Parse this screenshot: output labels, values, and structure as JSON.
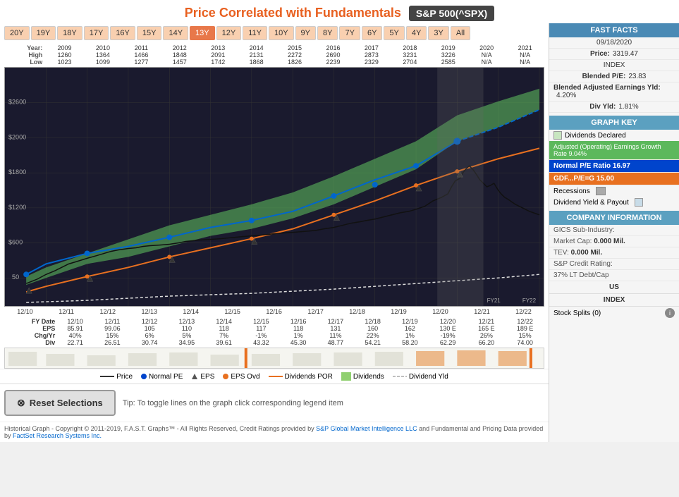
{
  "title": {
    "main": "Price Correlated with Fundamentals",
    "index": "S&P 500(^SPX)"
  },
  "timeButtons": [
    {
      "label": "20Y",
      "active": false
    },
    {
      "label": "19Y",
      "active": false
    },
    {
      "label": "18Y",
      "active": false
    },
    {
      "label": "17Y",
      "active": false
    },
    {
      "label": "16Y",
      "active": false
    },
    {
      "label": "15Y",
      "active": false
    },
    {
      "label": "14Y",
      "active": false
    },
    {
      "label": "13Y",
      "active": true
    },
    {
      "label": "12Y",
      "active": false
    },
    {
      "label": "11Y",
      "active": false
    },
    {
      "label": "10Y",
      "active": false
    },
    {
      "label": "9Y",
      "active": false
    },
    {
      "label": "8Y",
      "active": false
    },
    {
      "label": "7Y",
      "active": false
    },
    {
      "label": "6Y",
      "active": false
    },
    {
      "label": "5Y",
      "active": false
    },
    {
      "label": "4Y",
      "active": false
    },
    {
      "label": "3Y",
      "active": false
    },
    {
      "label": "All",
      "active": false
    }
  ],
  "yearRow": {
    "label": "Year:",
    "years": [
      "2009",
      "2010",
      "2011",
      "2012",
      "2013",
      "2014",
      "2015",
      "2016",
      "2017",
      "2018",
      "2019",
      "2020",
      "2021"
    ]
  },
  "highRow": {
    "label": "High",
    "values": [
      "1260",
      "1364",
      "1466",
      "1848",
      "2091",
      "2131",
      "2272",
      "2690",
      "2873",
      "3231",
      "3226",
      "N/A",
      "N/A"
    ]
  },
  "lowRow": {
    "label": "Low",
    "values": [
      "1023",
      "1099",
      "1277",
      "1457",
      "1742",
      "1868",
      "1826",
      "2239",
      "2329",
      "2704",
      "2585",
      "N/A",
      "N/A"
    ]
  },
  "xAxisLabels": [
    "12/10",
    "12/11",
    "12/12",
    "12/13",
    "12/14",
    "12/15",
    "12/16",
    "12/17",
    "12/18",
    "12/19",
    "12/20",
    "12/21",
    "12/22"
  ],
  "fyDate": {
    "label": "FY Date",
    "values": [
      "12/10",
      "12/11",
      "12/12",
      "12/13",
      "12/14",
      "12/15",
      "12/16",
      "12/17",
      "12/18",
      "12/19",
      "12/20",
      "12/21",
      "12/22"
    ]
  },
  "epsRow": {
    "label": "EPS",
    "values": [
      "85.91",
      "99.06",
      "105",
      "110",
      "118",
      "117",
      "118",
      "131",
      "160",
      "162",
      "130 E",
      "165 E",
      "189 E"
    ]
  },
  "chgRow": {
    "label": "Chg/Yr",
    "values": [
      "40%",
      "15%",
      "6%",
      "5%",
      "7%",
      "-1%",
      "1%",
      "11%",
      "22%",
      "1%",
      "-19%",
      "26%",
      "15%"
    ]
  },
  "divRow": {
    "label": "Div",
    "values": [
      "22.71",
      "26.51",
      "30.74",
      "34.95",
      "39.61",
      "43.32",
      "45.30",
      "48.77",
      "54.21",
      "58.20",
      "62.29",
      "66.20",
      "74.00"
    ]
  },
  "legend": [
    {
      "type": "line",
      "color": "#333",
      "label": "Price"
    },
    {
      "type": "dot",
      "color": "#0044cc",
      "label": "Normal PE"
    },
    {
      "type": "triangle",
      "color": "#333",
      "label": "EPS"
    },
    {
      "type": "dot",
      "color": "#e87020",
      "label": "EPS Ovd"
    },
    {
      "type": "line",
      "color": "#e87020",
      "label": "Dividends POR"
    },
    {
      "type": "fill",
      "color": "#90d070",
      "label": "Dividends"
    },
    {
      "type": "line",
      "color": "#aaa",
      "label": "Dividend Yld"
    }
  ],
  "resetButton": {
    "label": "Reset Selections",
    "hint": "Tip: To toggle lines on the graph click corresponding legend item"
  },
  "copyright": {
    "text1": "Historical Graph - Copyright © 2011-2019, F.A.S.T. Graphs™ - All Rights Reserved, Credit Ratings provided by ",
    "link1": "S&P Global Market Intelligence LLC",
    "text2": " and Fundamental and Pricing Data provided by ",
    "link2": "FactSet Research Systems Inc."
  },
  "fastFacts": {
    "header": "FAST FACTS",
    "date": "09/18/2020",
    "priceLabel": "Price:",
    "priceValue": "3319.47",
    "indexLabel": "INDEX",
    "peLabel": "Blended P/E:",
    "peValue": "23.83",
    "earningsLabel": "Blended Adjusted Earnings Yld:",
    "earningsValue": "4.20%",
    "divYldLabel": "Div Yld:",
    "divYldValue": "1.81%"
  },
  "graphKey": {
    "header": "GRAPH KEY",
    "dividendsLabel": "Dividends Declared",
    "adjEarningsLabel": "Adjusted (Operating) Earnings Growth Rate 9.04%",
    "normalPELabel": "Normal P/E Ratio 16.97",
    "gdfLabel": "GDF...P/E=G 15.00",
    "recessionsLabel": "Recessions",
    "divYieldLabel": "Dividend Yield & Payout"
  },
  "companyInfo": {
    "header": "COMPANY INFORMATION",
    "gicsLabel": "GICS Sub-Industry:",
    "gicsValue": "",
    "mktCapLabel": "Market Cap:",
    "mktCapValue": "0.000 Mil.",
    "tevLabel": "TEV:",
    "tevValue": "0.000 Mil.",
    "creditLabel": "S&P Credit Rating:",
    "creditValue": "",
    "debtLabel": "37% LT Debt/Cap"
  },
  "bottomLabels": {
    "us": "US",
    "index": "INDEX",
    "stockSplits": "Stock Splits (0)"
  },
  "yAxisLabels": [
    "$2600",
    "$2000",
    "$1800",
    "$1200",
    "$600",
    "50"
  ]
}
